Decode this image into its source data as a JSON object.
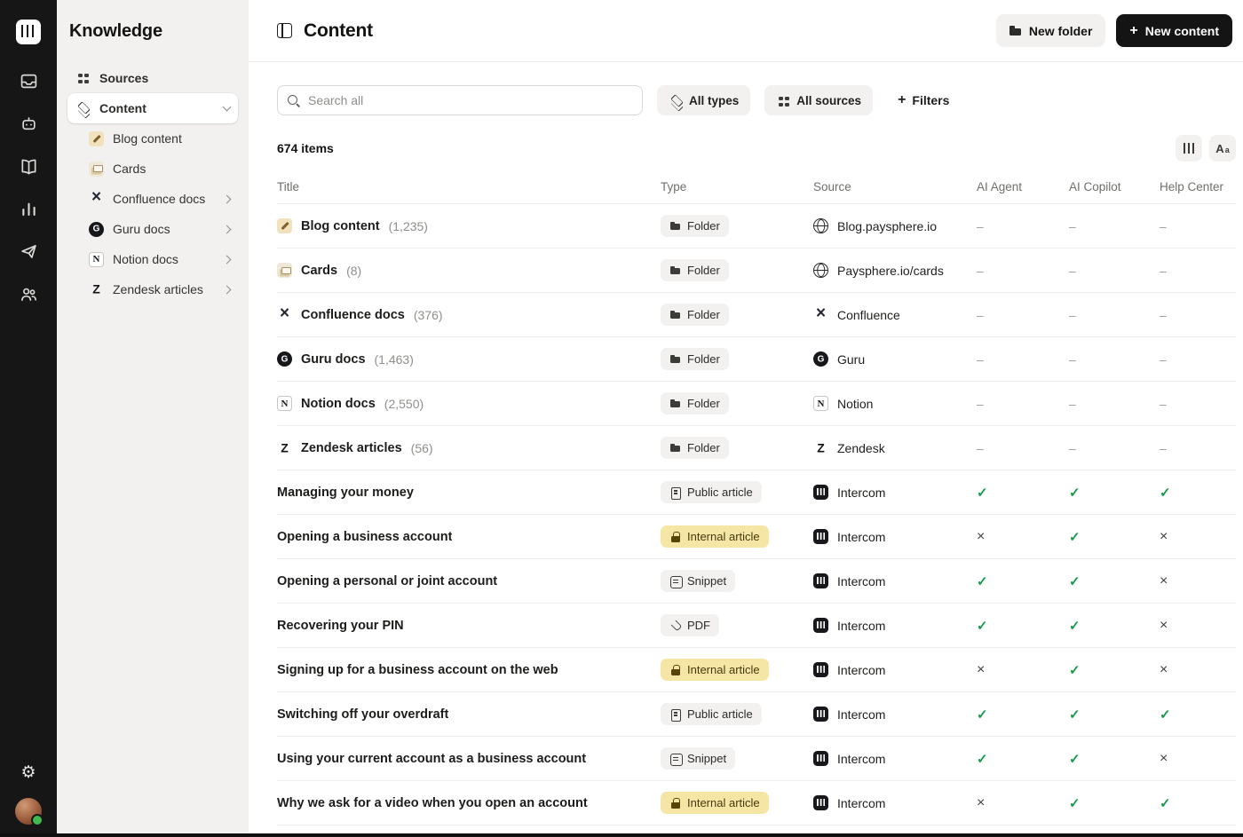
{
  "rail": {
    "icons": [
      "intercom-logo",
      "inbox",
      "fin-ai",
      "knowledge",
      "reports",
      "outbound",
      "contacts"
    ],
    "bottom_icons": [
      "settings",
      "avatar"
    ]
  },
  "sidebar": {
    "title": "Knowledge",
    "items": [
      {
        "label": "Sources",
        "icon": "sources"
      },
      {
        "label": "Content",
        "icon": "content"
      }
    ],
    "children": [
      {
        "label": "Blog content",
        "icon": "blog"
      },
      {
        "label": "Cards",
        "icon": "cards"
      },
      {
        "label": "Confluence docs",
        "icon": "confluence"
      },
      {
        "label": "Guru docs",
        "icon": "guru"
      },
      {
        "label": "Notion docs",
        "icon": "notion"
      },
      {
        "label": "Zendesk articles",
        "icon": "zendesk"
      }
    ]
  },
  "header": {
    "title": "Content",
    "new_folder": "New folder",
    "new_content": "New content",
    "plus": "+"
  },
  "toolbar": {
    "search_placeholder": "Search all",
    "all_types": "All types",
    "all_sources": "All sources",
    "filters": "Filters",
    "plus": "+"
  },
  "listbar": {
    "count": "674 items"
  },
  "table": {
    "columns": [
      "Title",
      "Type",
      "Source",
      "AI Agent",
      "AI Copilot",
      "Help Center"
    ],
    "rows": [
      {
        "title": "Blog content",
        "count": "(1,235)",
        "icon": "blog",
        "type": {
          "label": "Folder",
          "icon": "folder",
          "variant": "gray"
        },
        "source": {
          "label": "Blog.paysphere.io",
          "icon": "globe"
        },
        "ai_agent": {
          "glyph": "–",
          "kind": "dash"
        },
        "ai_copilot": {
          "glyph": "–",
          "kind": "dash"
        },
        "help_center": {
          "glyph": "–",
          "kind": "dash"
        }
      },
      {
        "title": "Cards",
        "count": "(8)",
        "icon": "cards",
        "type": {
          "label": "Folder",
          "icon": "folder",
          "variant": "gray"
        },
        "source": {
          "label": "Paysphere.io/cards",
          "icon": "globe"
        },
        "ai_agent": {
          "glyph": "–",
          "kind": "dash"
        },
        "ai_copilot": {
          "glyph": "–",
          "kind": "dash"
        },
        "help_center": {
          "glyph": "–",
          "kind": "dash"
        }
      },
      {
        "title": "Confluence docs",
        "count": "(376)",
        "icon": "confluence",
        "type": {
          "label": "Folder",
          "icon": "folder",
          "variant": "gray"
        },
        "source": {
          "label": "Confluence",
          "icon": "confluence"
        },
        "ai_agent": {
          "glyph": "–",
          "kind": "dash"
        },
        "ai_copilot": {
          "glyph": "–",
          "kind": "dash"
        },
        "help_center": {
          "glyph": "–",
          "kind": "dash"
        }
      },
      {
        "title": "Guru docs",
        "count": "(1,463)",
        "icon": "guru",
        "type": {
          "label": "Folder",
          "icon": "folder",
          "variant": "gray"
        },
        "source": {
          "label": "Guru",
          "icon": "guru"
        },
        "ai_agent": {
          "glyph": "–",
          "kind": "dash"
        },
        "ai_copilot": {
          "glyph": "–",
          "kind": "dash"
        },
        "help_center": {
          "glyph": "–",
          "kind": "dash"
        }
      },
      {
        "title": "Notion docs",
        "count": "(2,550)",
        "icon": "notion",
        "type": {
          "label": "Folder",
          "icon": "folder",
          "variant": "gray"
        },
        "source": {
          "label": "Notion",
          "icon": "notion"
        },
        "ai_agent": {
          "glyph": "–",
          "kind": "dash"
        },
        "ai_copilot": {
          "glyph": "–",
          "kind": "dash"
        },
        "help_center": {
          "glyph": "–",
          "kind": "dash"
        }
      },
      {
        "title": "Zendesk articles",
        "count": "(56)",
        "icon": "zendesk",
        "type": {
          "label": "Folder",
          "icon": "folder",
          "variant": "gray"
        },
        "source": {
          "label": "Zendesk",
          "icon": "zendesk"
        },
        "ai_agent": {
          "glyph": "–",
          "kind": "dash"
        },
        "ai_copilot": {
          "glyph": "–",
          "kind": "dash"
        },
        "help_center": {
          "glyph": "–",
          "kind": "dash"
        }
      },
      {
        "title": "Managing your money",
        "type": {
          "label": "Public article",
          "icon": "doc",
          "variant": "gray"
        },
        "source": {
          "label": "Intercom",
          "icon": "intercom"
        },
        "ai_agent": {
          "glyph": "✓",
          "kind": "check"
        },
        "ai_copilot": {
          "glyph": "✓",
          "kind": "check"
        },
        "help_center": {
          "glyph": "✓",
          "kind": "check"
        }
      },
      {
        "title": "Opening a business account",
        "type": {
          "label": "Internal article",
          "icon": "lock",
          "variant": "yellow"
        },
        "source": {
          "label": "Intercom",
          "icon": "intercom"
        },
        "ai_agent": {
          "glyph": "×",
          "kind": "cross"
        },
        "ai_copilot": {
          "glyph": "✓",
          "kind": "check"
        },
        "help_center": {
          "glyph": "×",
          "kind": "cross"
        }
      },
      {
        "title": "Opening a personal or joint account",
        "type": {
          "label": "Snippet",
          "icon": "snippet",
          "variant": "gray"
        },
        "source": {
          "label": "Intercom",
          "icon": "intercom"
        },
        "ai_agent": {
          "glyph": "✓",
          "kind": "check"
        },
        "ai_copilot": {
          "glyph": "✓",
          "kind": "check"
        },
        "help_center": {
          "glyph": "×",
          "kind": "cross"
        }
      },
      {
        "title": "Recovering your PIN",
        "type": {
          "label": "PDF",
          "icon": "clip",
          "variant": "gray"
        },
        "source": {
          "label": "Intercom",
          "icon": "intercom"
        },
        "ai_agent": {
          "glyph": "✓",
          "kind": "check"
        },
        "ai_copilot": {
          "glyph": "✓",
          "kind": "check"
        },
        "help_center": {
          "glyph": "×",
          "kind": "cross"
        }
      },
      {
        "title": "Signing up for a business account on the web",
        "type": {
          "label": "Internal article",
          "icon": "lock",
          "variant": "yellow"
        },
        "source": {
          "label": "Intercom",
          "icon": "intercom"
        },
        "ai_agent": {
          "glyph": "×",
          "kind": "cross"
        },
        "ai_copilot": {
          "glyph": "✓",
          "kind": "check"
        },
        "help_center": {
          "glyph": "×",
          "kind": "cross"
        }
      },
      {
        "title": "Switching off your overdraft",
        "type": {
          "label": "Public article",
          "icon": "doc",
          "variant": "gray"
        },
        "source": {
          "label": "Intercom",
          "icon": "intercom"
        },
        "ai_agent": {
          "glyph": "✓",
          "kind": "check"
        },
        "ai_copilot": {
          "glyph": "✓",
          "kind": "check"
        },
        "help_center": {
          "glyph": "✓",
          "kind": "check"
        }
      },
      {
        "title": "Using your current account as a business account",
        "type": {
          "label": "Snippet",
          "icon": "snippet",
          "variant": "gray"
        },
        "source": {
          "label": "Intercom",
          "icon": "intercom"
        },
        "ai_agent": {
          "glyph": "✓",
          "kind": "check"
        },
        "ai_copilot": {
          "glyph": "✓",
          "kind": "check"
        },
        "help_center": {
          "glyph": "×",
          "kind": "cross"
        }
      },
      {
        "title": "Why we ask for a video when you open an account",
        "type": {
          "label": "Internal article",
          "icon": "lock",
          "variant": "yellow"
        },
        "source": {
          "label": "Intercom",
          "icon": "intercom"
        },
        "ai_agent": {
          "glyph": "×",
          "kind": "cross"
        },
        "ai_copilot": {
          "glyph": "✓",
          "kind": "check"
        },
        "help_center": {
          "glyph": "✓",
          "kind": "check"
        }
      }
    ]
  }
}
